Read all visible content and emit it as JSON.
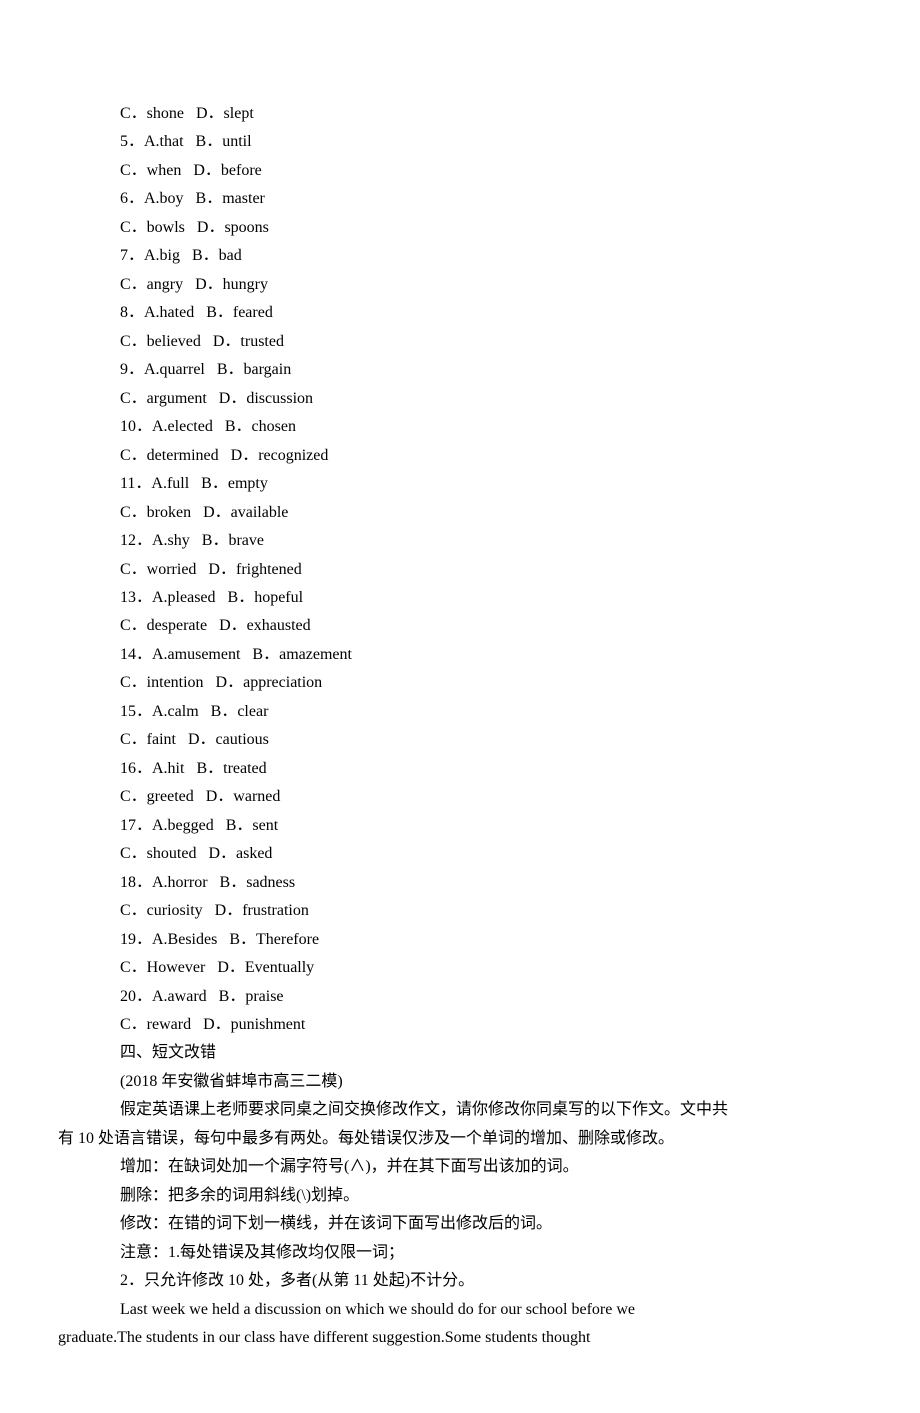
{
  "items": [
    {
      "indent": "indent-1",
      "text": "C．shone   D．slept"
    },
    {
      "indent": "indent-1",
      "text": "5．A.that   B．until"
    },
    {
      "indent": "indent-1",
      "text": "C．when   D．before"
    },
    {
      "indent": "indent-1",
      "text": "6．A.boy   B．master"
    },
    {
      "indent": "indent-1",
      "text": "C．bowls   D．spoons"
    },
    {
      "indent": "indent-1",
      "text": "7．A.big   B．bad"
    },
    {
      "indent": "indent-1",
      "text": "C．angry   D．hungry"
    },
    {
      "indent": "indent-1",
      "text": "8．A.hated   B．feared"
    },
    {
      "indent": "indent-1",
      "text": "C．believed   D．trusted"
    },
    {
      "indent": "indent-1",
      "text": "9．A.quarrel   B．bargain"
    },
    {
      "indent": "indent-1",
      "text": "C．argument   D．discussion"
    },
    {
      "indent": "indent-1",
      "text": "10．A.elected   B．chosen"
    },
    {
      "indent": "indent-1",
      "text": "C．determined   D．recognized"
    },
    {
      "indent": "indent-1",
      "text": "11．A.full   B．empty"
    },
    {
      "indent": "indent-1",
      "text": "C．broken   D．available"
    },
    {
      "indent": "indent-1",
      "text": "12．A.shy   B．brave"
    },
    {
      "indent": "indent-1",
      "text": "C．worried   D．frightened"
    },
    {
      "indent": "indent-1",
      "text": "13．A.pleased   B．hopeful"
    },
    {
      "indent": "indent-1",
      "text": "C．desperate   D．exhausted"
    },
    {
      "indent": "indent-1",
      "text": "14．A.amusement   B．amazement"
    },
    {
      "indent": "indent-1",
      "text": "C．intention   D．appreciation"
    },
    {
      "indent": "indent-1",
      "text": "15．A.calm   B．clear"
    },
    {
      "indent": "indent-1",
      "text": "C．faint   D．cautious"
    },
    {
      "indent": "indent-1",
      "text": "16．A.hit   B．treated"
    },
    {
      "indent": "indent-1",
      "text": "C．greeted   D．warned"
    },
    {
      "indent": "indent-1",
      "text": "17．A.begged   B．sent"
    },
    {
      "indent": "indent-1",
      "text": "C．shouted   D．asked"
    },
    {
      "indent": "indent-1",
      "text": "18．A.horror   B．sadness"
    },
    {
      "indent": "indent-1",
      "text": "C．curiosity   D．frustration"
    },
    {
      "indent": "indent-1",
      "text": "19．A.Besides   B．Therefore"
    },
    {
      "indent": "indent-1",
      "text": "C．However   D．Eventually"
    },
    {
      "indent": "indent-1",
      "text": "20．A.award   B．praise"
    },
    {
      "indent": "indent-1",
      "text": "C．reward   D．punishment"
    },
    {
      "indent": "indent-1",
      "text": "四、短文改错"
    },
    {
      "indent": "indent-1",
      "text": "(2018 年安徽省蚌埠市高三二模)"
    },
    {
      "indent": "indent-1",
      "text": "假定英语课上老师要求同桌之间交换修改作文，请你修改你同桌写的以下作文。文中共"
    },
    {
      "indent": "no-indent",
      "text": "有 10 处语言错误，每句中最多有两处。每处错误仅涉及一个单词的增加、删除或修改。"
    },
    {
      "indent": "indent-1",
      "text": "增加：在缺词处加一个漏字符号(∧)，并在其下面写出该加的词。"
    },
    {
      "indent": "indent-1",
      "text": "删除：把多余的词用斜线(\\)划掉。"
    },
    {
      "indent": "indent-1",
      "text": "修改：在错的词下划一横线，并在该词下面写出修改后的词。"
    },
    {
      "indent": "indent-1",
      "text": "注意：1.每处错误及其修改均仅限一词；"
    },
    {
      "indent": "indent-1",
      "text": "2．只允许修改 10 处，多者(从第 11 处起)不计分。"
    },
    {
      "indent": "indent-1",
      "text": "Last week we held a discussion on which we should do for our school before we"
    },
    {
      "indent": "no-indent",
      "text": "graduate.The students in our class have different suggestion.Some students thought"
    }
  ]
}
